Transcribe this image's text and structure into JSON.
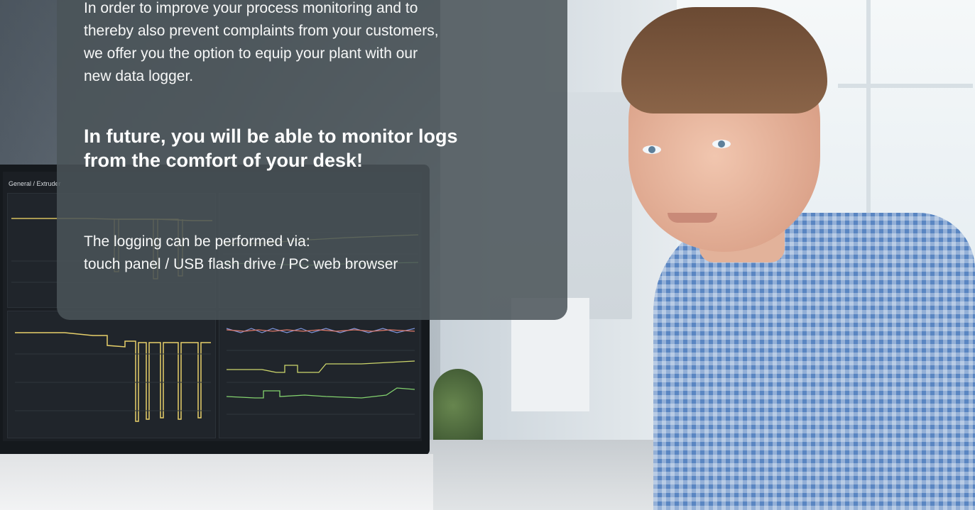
{
  "hero": {
    "intro_text": "In order to improve your process monitoring and to\nthereby also prevent complaints from your customers,\nwe offer you the option to equip your plant with our\nnew data logger.",
    "headline": "In future, you will be able to monitor logs\nfrom the comfort of your desk!",
    "logging_text": "The logging can be performed via:\ntouch panel / USB flash drive / PC web browser"
  },
  "monitor_screen": {
    "title": "General / Extruder"
  },
  "colors": {
    "card_background": "#4b5459",
    "headline": "#ffffff",
    "body_text": "#f6f7f7"
  }
}
